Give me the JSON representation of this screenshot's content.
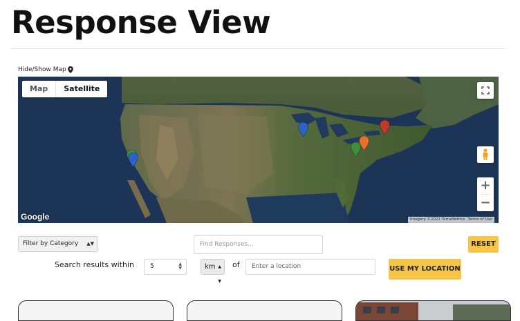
{
  "page": {
    "title": "Response View"
  },
  "map_toggle": {
    "label": "Hide/Show Map",
    "icon": "map-marker-icon"
  },
  "map": {
    "type_controls": {
      "map": "Map",
      "satellite": "Satellite",
      "selected": "Satellite"
    },
    "logo": "Google",
    "attribution": {
      "imagery": "Imagery ©2021 TerraMetrics",
      "terms": "Terms of Use"
    },
    "zoom": {
      "in": "+",
      "out": "−"
    },
    "pin_colors": {
      "blue": "#2c63c9",
      "green": "#3f8f3a",
      "orange": "#e8702a",
      "red": "#c0392b"
    },
    "markers": [
      {
        "color": "green"
      },
      {
        "color": "blue"
      },
      {
        "color": "blue"
      },
      {
        "color": "green"
      },
      {
        "color": "orange"
      },
      {
        "color": "red"
      }
    ]
  },
  "filters": {
    "category": {
      "selected": "Filter by Category"
    },
    "search": {
      "placeholder": "Find Responses..."
    },
    "reset_label": "RESET",
    "within_label": "Search results within",
    "radius": {
      "value": "5"
    },
    "unit": {
      "selected": "km"
    },
    "of_label": "of",
    "location": {
      "placeholder": "Enter a location"
    },
    "my_location_label": "USE MY LOCATION"
  },
  "colors": {
    "accent": "#f7c548",
    "title": "#111111"
  }
}
